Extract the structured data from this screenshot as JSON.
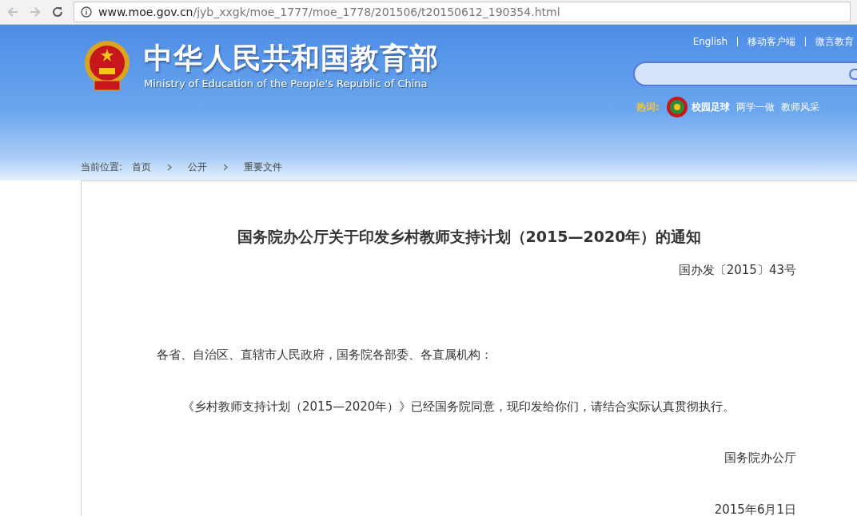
{
  "browser": {
    "url_host": "www.moe.gov.cn",
    "url_path": "/jyb_xxgk/moe_1777/moe_1778/201506/t20150612_190354.html"
  },
  "header": {
    "title": "中华人民共和国教育部",
    "subtitle": "Ministry of Education of the People's Republic of China",
    "top_links": [
      "English",
      "移动客户端",
      "微言教育"
    ],
    "hot_label": "热词:",
    "hot_words": [
      {
        "text": "校园足球",
        "kind": "badge"
      },
      {
        "text": "两学一做",
        "kind": "plain"
      },
      {
        "text": "教师风采",
        "kind": "plain"
      }
    ]
  },
  "breadcrumb": {
    "label": "当前位置:",
    "items": [
      "首页",
      "公开",
      "重要文件"
    ]
  },
  "article": {
    "title": "国务院办公厅关于印发乡村教师支持计划（2015—2020年）的通知",
    "doc_number": "国办发〔2015〕43号",
    "salutation": "各省、自治区、直辖市人民政府，国务院各部委、各直属机构：",
    "body": "《乡村教师支持计划（2015—2020年）》已经国务院同意，现印发给你们，请结合实际认真贯彻执行。",
    "signature": "国务院办公厅",
    "date": "2015年6月1日"
  }
}
